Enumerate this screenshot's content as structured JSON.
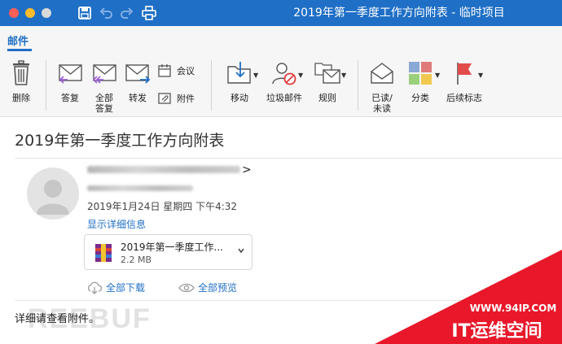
{
  "window": {
    "title": "2019年第一季度工作方向附表 - 临时项目",
    "accent": "#1f6fc6"
  },
  "ribbon": {
    "tab_mail": "邮件",
    "delete": "删除",
    "reply": "答复",
    "reply_all_line1": "全部",
    "reply_all_line2": "答复",
    "forward": "转发",
    "meeting": "会议",
    "attachment": "附件",
    "move": "移动",
    "junk": "垃圾邮件",
    "rules": "规则",
    "read_unread_line1": "已读/",
    "read_unread_line2": "未读",
    "categorize": "分类",
    "follow_up": "后续标志"
  },
  "message": {
    "subject": "2019年第一季度工作方向附表",
    "sender_suffix": ">",
    "date": "2019年1月24日 星期四 下午4:32",
    "show_details": "显示详细信息",
    "attachment": {
      "name": "2019年第一季度工作...",
      "size": "2.2 MB"
    },
    "download_all": "全部下载",
    "preview_all": "全部预览",
    "body": "详细请查看附件。"
  },
  "watermark": {
    "freebuf": "REEBUF",
    "site": "WWW.94IP.COM",
    "brand": "IT运维空间",
    "brand_color": "#e8182a"
  }
}
